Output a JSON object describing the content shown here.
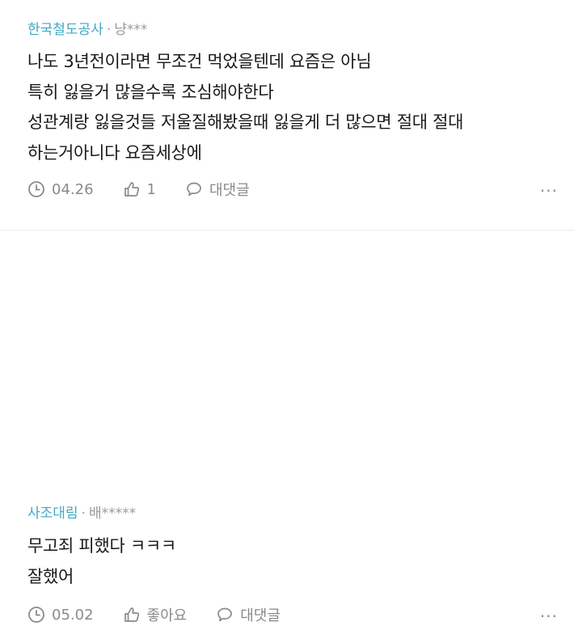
{
  "comments": [
    {
      "company": "한국철도공사",
      "separator": "·",
      "user": "냥***",
      "lines": [
        "나도 3년전이라면 무조건 먹었을텐데 요즘은 아님",
        "특히 잃을거 많을수록 조심해야한다",
        "성관계랑 잃을것들 저울질해봤을때 잃을게 더 많으면 절대 절대",
        "하는거아니다 요즘세상에"
      ],
      "date": "04.26",
      "like_label": "1",
      "reply_label": "대댓글",
      "more": "···"
    },
    {
      "company": "사조대림",
      "separator": "·",
      "user": "배*****",
      "lines": [
        "무고죄 피했다 ㅋㅋㅋ",
        "잘했어"
      ],
      "date": "05.02",
      "like_label": "좋아요",
      "reply_label": "대댓글",
      "more": "···"
    }
  ]
}
